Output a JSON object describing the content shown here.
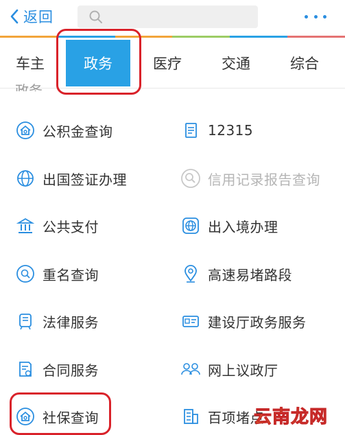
{
  "header": {
    "back_label": "返回",
    "search_placeholder": ""
  },
  "color_strip": [
    "#f2a53a",
    "#29a1e5",
    "#f2a53a",
    "#9ccc65",
    "#29a1e5",
    "#e57373"
  ],
  "tabs": [
    {
      "label": "车主",
      "active": false
    },
    {
      "label": "政务",
      "active": true
    },
    {
      "label": "医疗",
      "active": false
    },
    {
      "label": "交通",
      "active": false
    },
    {
      "label": "综合",
      "active": false
    }
  ],
  "section": {
    "title": "政务"
  },
  "items": [
    {
      "label": "公积金查询",
      "icon": "home-badge-icon",
      "enabled": true
    },
    {
      "label": "12315",
      "icon": "document-icon",
      "enabled": true
    },
    {
      "label": "出国签证办理",
      "icon": "globe-icon",
      "enabled": true
    },
    {
      "label": "信用记录报告查询",
      "icon": "credit-search-icon",
      "enabled": false
    },
    {
      "label": "公共支付",
      "icon": "bank-icon",
      "enabled": true
    },
    {
      "label": "出入境办理",
      "icon": "globe-badge-icon",
      "enabled": true
    },
    {
      "label": "重名查询",
      "icon": "name-search-icon",
      "enabled": true
    },
    {
      "label": "高速易堵路段",
      "icon": "location-pin-icon",
      "enabled": true
    },
    {
      "label": "法律服务",
      "icon": "law-icon",
      "enabled": true
    },
    {
      "label": "建设厅政务服务",
      "icon": "id-card-icon",
      "enabled": true
    },
    {
      "label": "合同服务",
      "icon": "contract-icon",
      "enabled": true
    },
    {
      "label": "网上议政厅",
      "icon": "people-icon",
      "enabled": true
    },
    {
      "label": "社保查询",
      "icon": "home-badge-icon",
      "enabled": true
    },
    {
      "label": "百项堵点",
      "icon": "building-icon",
      "enabled": true
    }
  ],
  "watermark": {
    "text": "云南龙网"
  },
  "accent": "#2a8ee0",
  "highlight_color": "#d9222a"
}
